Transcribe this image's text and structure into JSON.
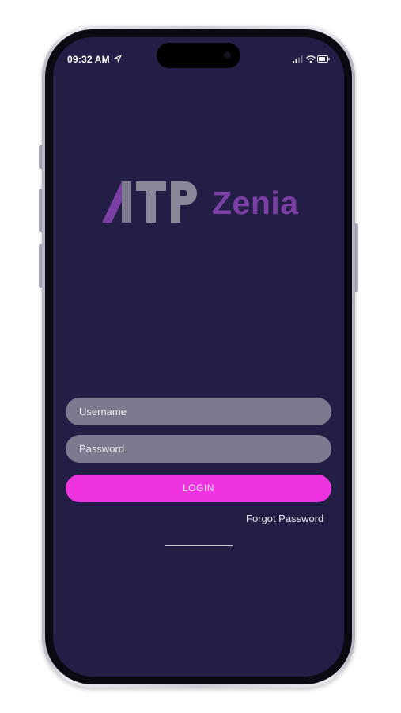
{
  "status_bar": {
    "time": "09:32 AM",
    "location_icon": "location-arrow-icon",
    "signal_icon": "cellular-signal-icon",
    "wifi_icon": "wifi-icon",
    "battery_icon": "battery-icon"
  },
  "logo": {
    "brand": "ATP",
    "product": "Zenia",
    "colors": {
      "atp_dark": "#5d5a6d",
      "atp_light": "#8c899a",
      "atp_accent": "#7b3ea4",
      "zenia": "#7b3ea4"
    }
  },
  "login_form": {
    "username_placeholder": "Username",
    "username_value": "",
    "password_placeholder": "Password",
    "password_value": "",
    "login_label": "LOGIN",
    "forgot_password_label": "Forgot Password"
  },
  "colors": {
    "background": "#221e45",
    "input": "#7d7a90",
    "login_button": "#ee34e0"
  }
}
